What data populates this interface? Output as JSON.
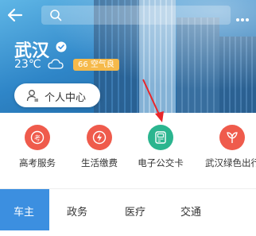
{
  "header": {
    "search_placeholder": "",
    "city": "武汉",
    "temperature": "23℃",
    "aqi_text": "66 空气良"
  },
  "user_center": {
    "label": "个人中心"
  },
  "services": [
    {
      "label": "高考服务",
      "icon": "exam-icon",
      "color": "#ef5b4c"
    },
    {
      "label": "生活缴费",
      "icon": "payment-icon",
      "color": "#ef5b4c"
    },
    {
      "label": "电子公交卡",
      "icon": "bus-card-icon",
      "color": "#2bb58f"
    },
    {
      "label": "武汉绿色出行",
      "icon": "leaf-icon",
      "color": "#ef5b4c"
    }
  ],
  "tabs": [
    {
      "label": "车主",
      "active": true
    },
    {
      "label": "政务",
      "active": false
    },
    {
      "label": "医疗",
      "active": false
    },
    {
      "label": "交通",
      "active": false
    }
  ],
  "colors": {
    "primary": "#3c8fe0",
    "aqi_badge": "#f5b94a",
    "arrow": "#e8262a"
  }
}
